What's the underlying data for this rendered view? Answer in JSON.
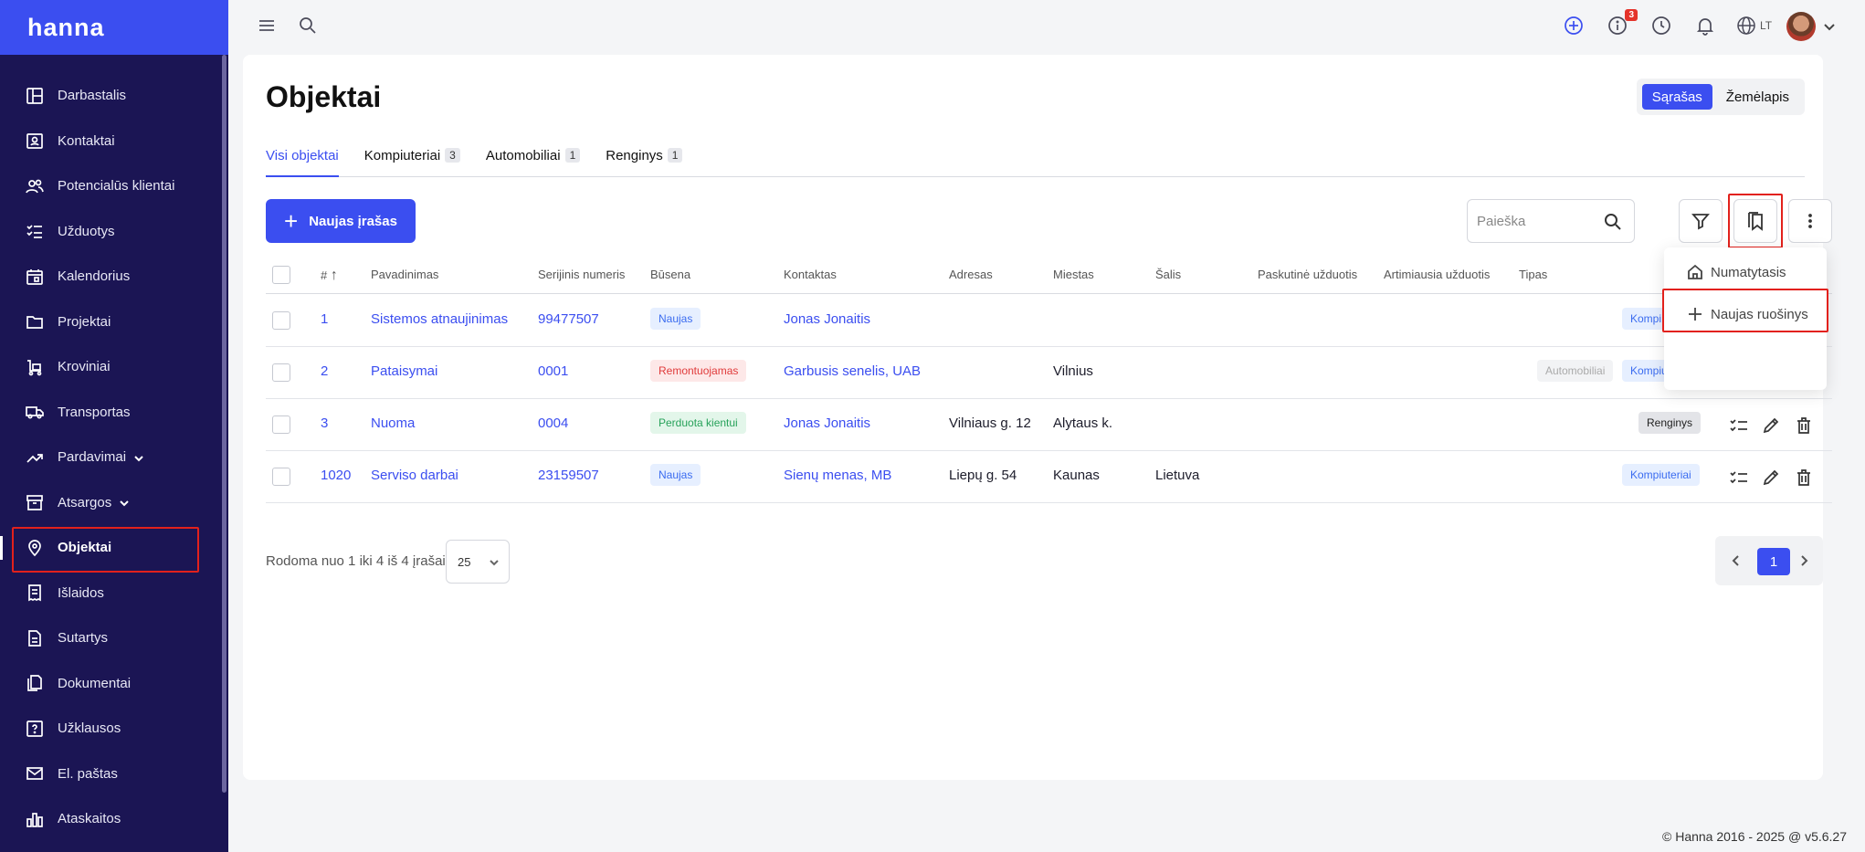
{
  "app": {
    "logo": "hanna"
  },
  "sidebar": {
    "items": [
      {
        "label": "Darbastalis",
        "icon": "dashboard-icon"
      },
      {
        "label": "Kontaktai",
        "icon": "contacts-icon"
      },
      {
        "label": "Potencialūs klientai",
        "icon": "leads-icon"
      },
      {
        "label": "Užduotys",
        "icon": "tasks-icon"
      },
      {
        "label": "Kalendorius",
        "icon": "calendar-icon"
      },
      {
        "label": "Projektai",
        "icon": "folder-icon"
      },
      {
        "label": "Kroviniai",
        "icon": "cargo-icon"
      },
      {
        "label": "Transportas",
        "icon": "truck-icon"
      },
      {
        "label": "Pardavimai",
        "icon": "sales-icon"
      },
      {
        "label": "Atsargos",
        "icon": "stock-icon"
      },
      {
        "label": "Objektai",
        "icon": "location-pin-icon"
      },
      {
        "label": "Išlaidos",
        "icon": "expenses-icon"
      },
      {
        "label": "Sutartys",
        "icon": "contract-icon"
      },
      {
        "label": "Dokumentai",
        "icon": "documents-icon"
      },
      {
        "label": "Užklausos",
        "icon": "inquiries-icon"
      },
      {
        "label": "El. paštas",
        "icon": "mail-icon"
      },
      {
        "label": "Ataskaitos",
        "icon": "reports-icon"
      }
    ]
  },
  "topbar": {
    "notification_count": "3",
    "language": "LT"
  },
  "page": {
    "title": "Objektai",
    "view_list": "Sąrašas",
    "view_map": "Žemėlapis"
  },
  "tabs": [
    {
      "label": "Visi objektai",
      "count": ""
    },
    {
      "label": "Kompiuteriai",
      "count": "3"
    },
    {
      "label": "Automobiliai",
      "count": "1"
    },
    {
      "label": "Renginys",
      "count": "1"
    }
  ],
  "toolbar": {
    "new_button": "Naujas įrašas",
    "search_placeholder": "Paieška"
  },
  "dropdown": {
    "default": "Numatytasis",
    "new_draft": "Naujas ruošinys"
  },
  "table": {
    "headers": {
      "num": "#",
      "name": "Pavadinimas",
      "serial": "Serijinis numeris",
      "status": "Būsena",
      "contact": "Kontaktas",
      "address": "Adresas",
      "city": "Miestas",
      "country": "Šalis",
      "last_task": "Paskutinė užduotis",
      "next_task": "Artimiausia užduotis",
      "type": "Tipas"
    },
    "rows": [
      {
        "num": "1",
        "name": "Sistemos atnaujinimas",
        "serial": "99477507",
        "status": "Naujas",
        "contact": "Jonas Jonaitis",
        "address": "",
        "city": "",
        "country": "",
        "type_visible": "Kompi"
      },
      {
        "num": "2",
        "name": "Pataisymai",
        "serial": "0001",
        "status": "Remontuojamas",
        "contact": "Garbusis senelis, UAB",
        "address": "",
        "city": "Vilnius",
        "country": "",
        "types": [
          "Automobiliai",
          "Kompiuteriai"
        ]
      },
      {
        "num": "3",
        "name": "Nuoma",
        "serial": "0004",
        "status": "Perduota kientui",
        "contact": "Jonas Jonaitis",
        "address": "Vilniaus g. 12",
        "city": "Alytaus k.",
        "country": "",
        "types": [
          "Renginys"
        ]
      },
      {
        "num": "1020",
        "name": "Serviso darbai",
        "serial": "23159507",
        "status": "Naujas",
        "contact": "Sienų menas, MB",
        "address": "Liepų g. 54",
        "city": "Kaunas",
        "country": "Lietuva",
        "types": [
          "Kompiuteriai"
        ]
      }
    ]
  },
  "footer": {
    "showing": "Rodoma nuo 1 iki 4 iš 4 įrašai",
    "per_page": "25",
    "current_page": "1",
    "copyright": "© Hanna 2016 - 2025 @ v5.6.27"
  },
  "colors": {
    "accent": "#3b4ef0",
    "sidebar": "#1b1554",
    "highlight": "#e2211c"
  }
}
